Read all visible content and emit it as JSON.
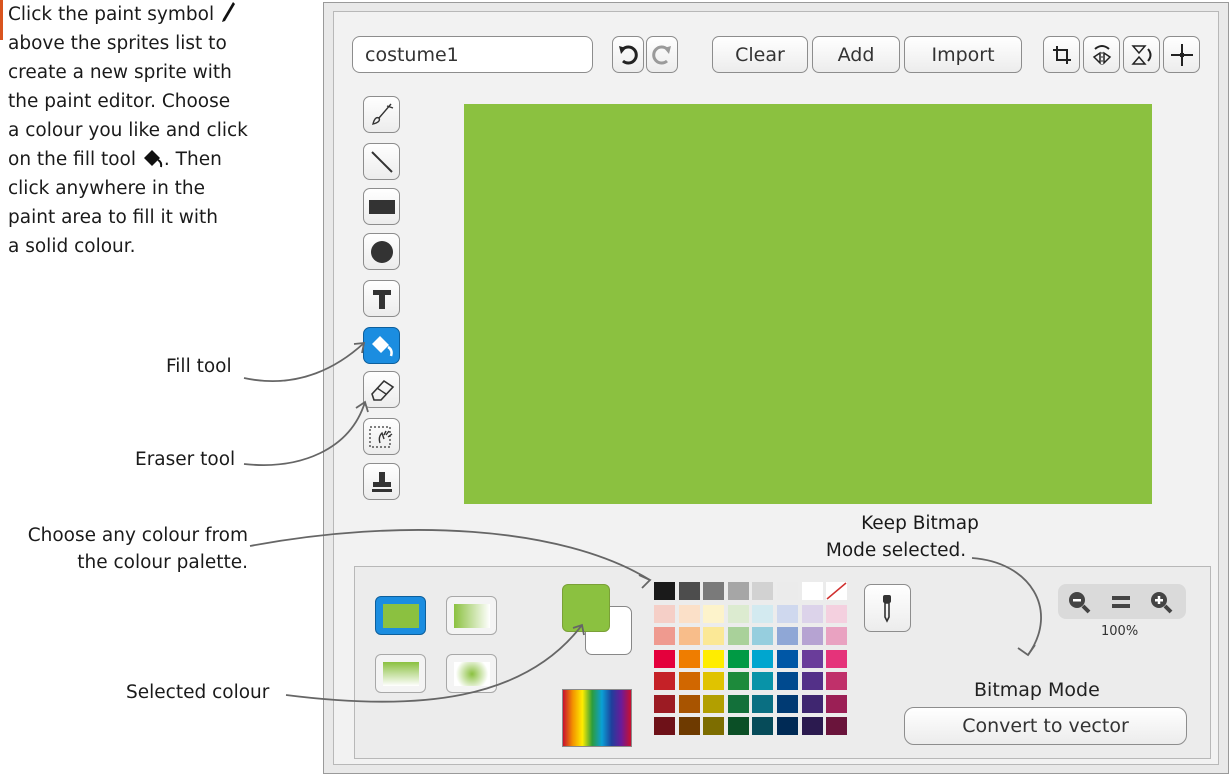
{
  "intro": {
    "line1": "Click the paint symbol",
    "line2": "above the sprites list to",
    "line3": "create a new sprite with",
    "line4": "the paint editor. Choose",
    "line5": "a colour you like and click",
    "line6": "on the fill tool",
    "line6b": ". Then",
    "line7": "click anywhere in the",
    "line8": "paint area to fill it with",
    "line9": "a solid colour."
  },
  "annotations": {
    "fill_tool": "Fill tool",
    "eraser_tool": "Eraser tool",
    "palette_1": "Choose any colour from",
    "palette_2": "the colour palette.",
    "bitmap_1": "Keep Bitmap",
    "bitmap_2": "Mode selected.",
    "selected_colour": "Selected colour"
  },
  "toolbar": {
    "costume_name": "costume1",
    "clear_label": "Clear",
    "add_label": "Add",
    "import_label": "Import"
  },
  "tools": [
    "brush-icon",
    "line-icon",
    "rectangle-icon",
    "ellipse-icon",
    "text-icon",
    "fill-icon",
    "eraser-icon",
    "select-icon",
    "stamp-icon"
  ],
  "active_tool": "fill-icon",
  "colors": {
    "canvas": "#8bc140",
    "selected_primary": "#8bc140",
    "selected_secondary": "#ffffff",
    "accent_blue": "#1b8de0"
  },
  "palette": [
    [
      "#1a1a1a",
      "#4d4d4d",
      "#7a7a7a",
      "#a6a6a6",
      "#d2d2d2",
      "#ebebeb",
      "#ffffff",
      "none"
    ],
    [
      "#f5cfc7",
      "#fbe0c8",
      "#fdf3cb",
      "#dcebd0",
      "#d3eaf0",
      "#cfd8ee",
      "#dcd3ea",
      "#f4d0df"
    ],
    [
      "#ef9a8f",
      "#f8bd8a",
      "#fbe896",
      "#a9d19a",
      "#96cede",
      "#8fa7d6",
      "#b6a3d2",
      "#e9a2c1"
    ],
    [
      "#e4003c",
      "#ef7d00",
      "#ffed00",
      "#009a44",
      "#00a6cf",
      "#0057a6",
      "#6a3d9a",
      "#e5337a"
    ],
    [
      "#c52127",
      "#d16700",
      "#e0c300",
      "#1d8a3b",
      "#0893a8",
      "#004a8f",
      "#533088",
      "#c0306a"
    ],
    [
      "#9c1b23",
      "#a85400",
      "#b29f00",
      "#13703a",
      "#0a6f82",
      "#003a73",
      "#3f2670",
      "#9b1f55"
    ],
    [
      "#6e1118",
      "#6e3a00",
      "#7d6d00",
      "#0b4f26",
      "#064b59",
      "#002a55",
      "#2b1a4f",
      "#6a143b"
    ]
  ],
  "zoom": {
    "value": "100%"
  },
  "mode": {
    "label": "Bitmap Mode",
    "convert_label": "Convert to vector"
  }
}
